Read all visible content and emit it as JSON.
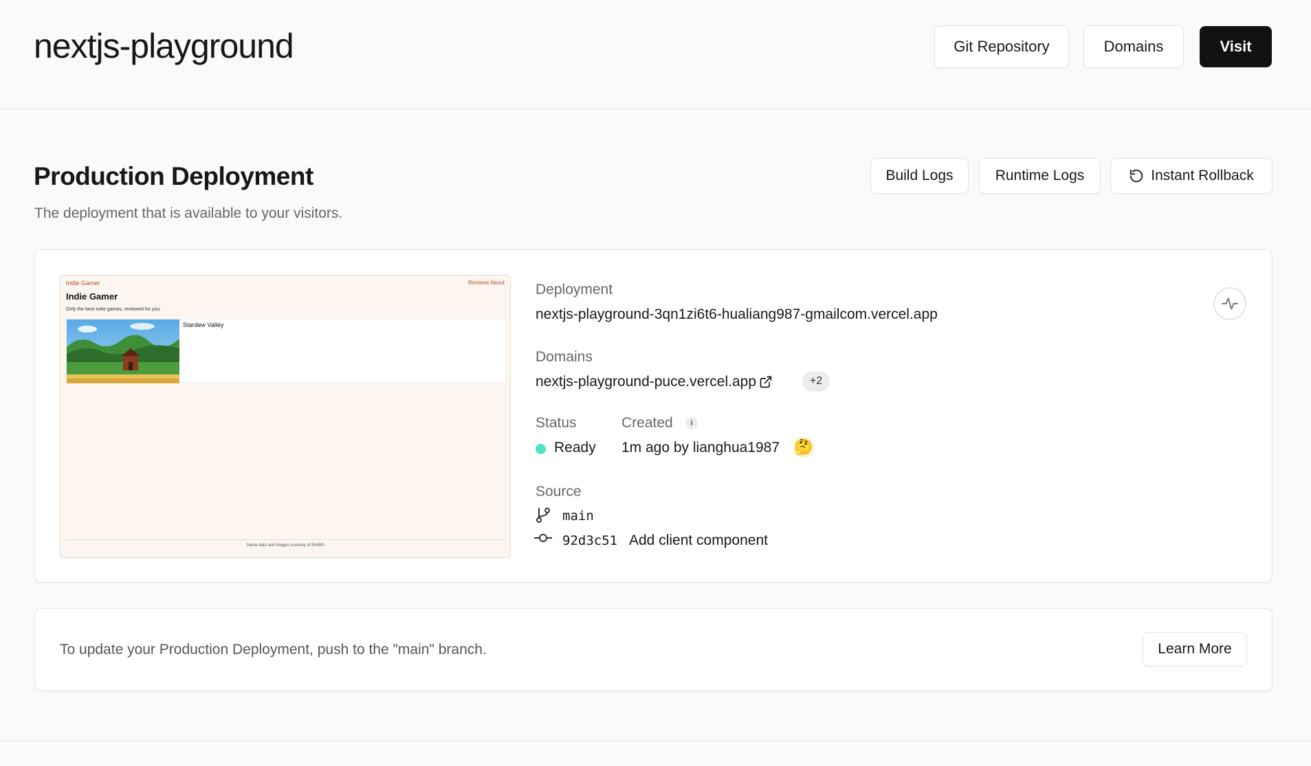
{
  "header": {
    "title": "nextjs-playground",
    "buttons": {
      "git_repository": "Git Repository",
      "domains": "Domains",
      "visit": "Visit"
    }
  },
  "production": {
    "title": "Production Deployment",
    "subtitle": "The deployment that is available to your visitors.",
    "buttons": {
      "build_logs": "Build Logs",
      "runtime_logs": "Runtime Logs",
      "instant_rollback": "Instant Rollback"
    }
  },
  "preview": {
    "brand": "Indie Gamer",
    "nav": "Reviews  About",
    "heading": "Indie Gamer",
    "tagline": "Only the best indie games, reviewed for you.",
    "game_title": "Stardew Valley",
    "footer": "Game data and images courtesy of RAWG"
  },
  "deployment": {
    "label": "Deployment",
    "url": "nextjs-playground-3qn1zi6t6-hualiang987-gmailcom.vercel.app",
    "domains_label": "Domains",
    "domain": "nextjs-playground-puce.vercel.app",
    "more_domains": "+2",
    "status_label": "Status",
    "status": "Ready",
    "status_color": "#50e3c2",
    "created_label": "Created",
    "created": "1m ago by lianghua1987",
    "avatar_emoji": "🤔",
    "source_label": "Source",
    "branch": "main",
    "commit_hash": "92d3c51",
    "commit_message": "Add client component"
  },
  "banner": {
    "text": "To update your Production Deployment, push to the \"main\" branch.",
    "button": "Learn More"
  },
  "colors": {
    "accent_dark": "#111111",
    "ready": "#50e3c2"
  }
}
